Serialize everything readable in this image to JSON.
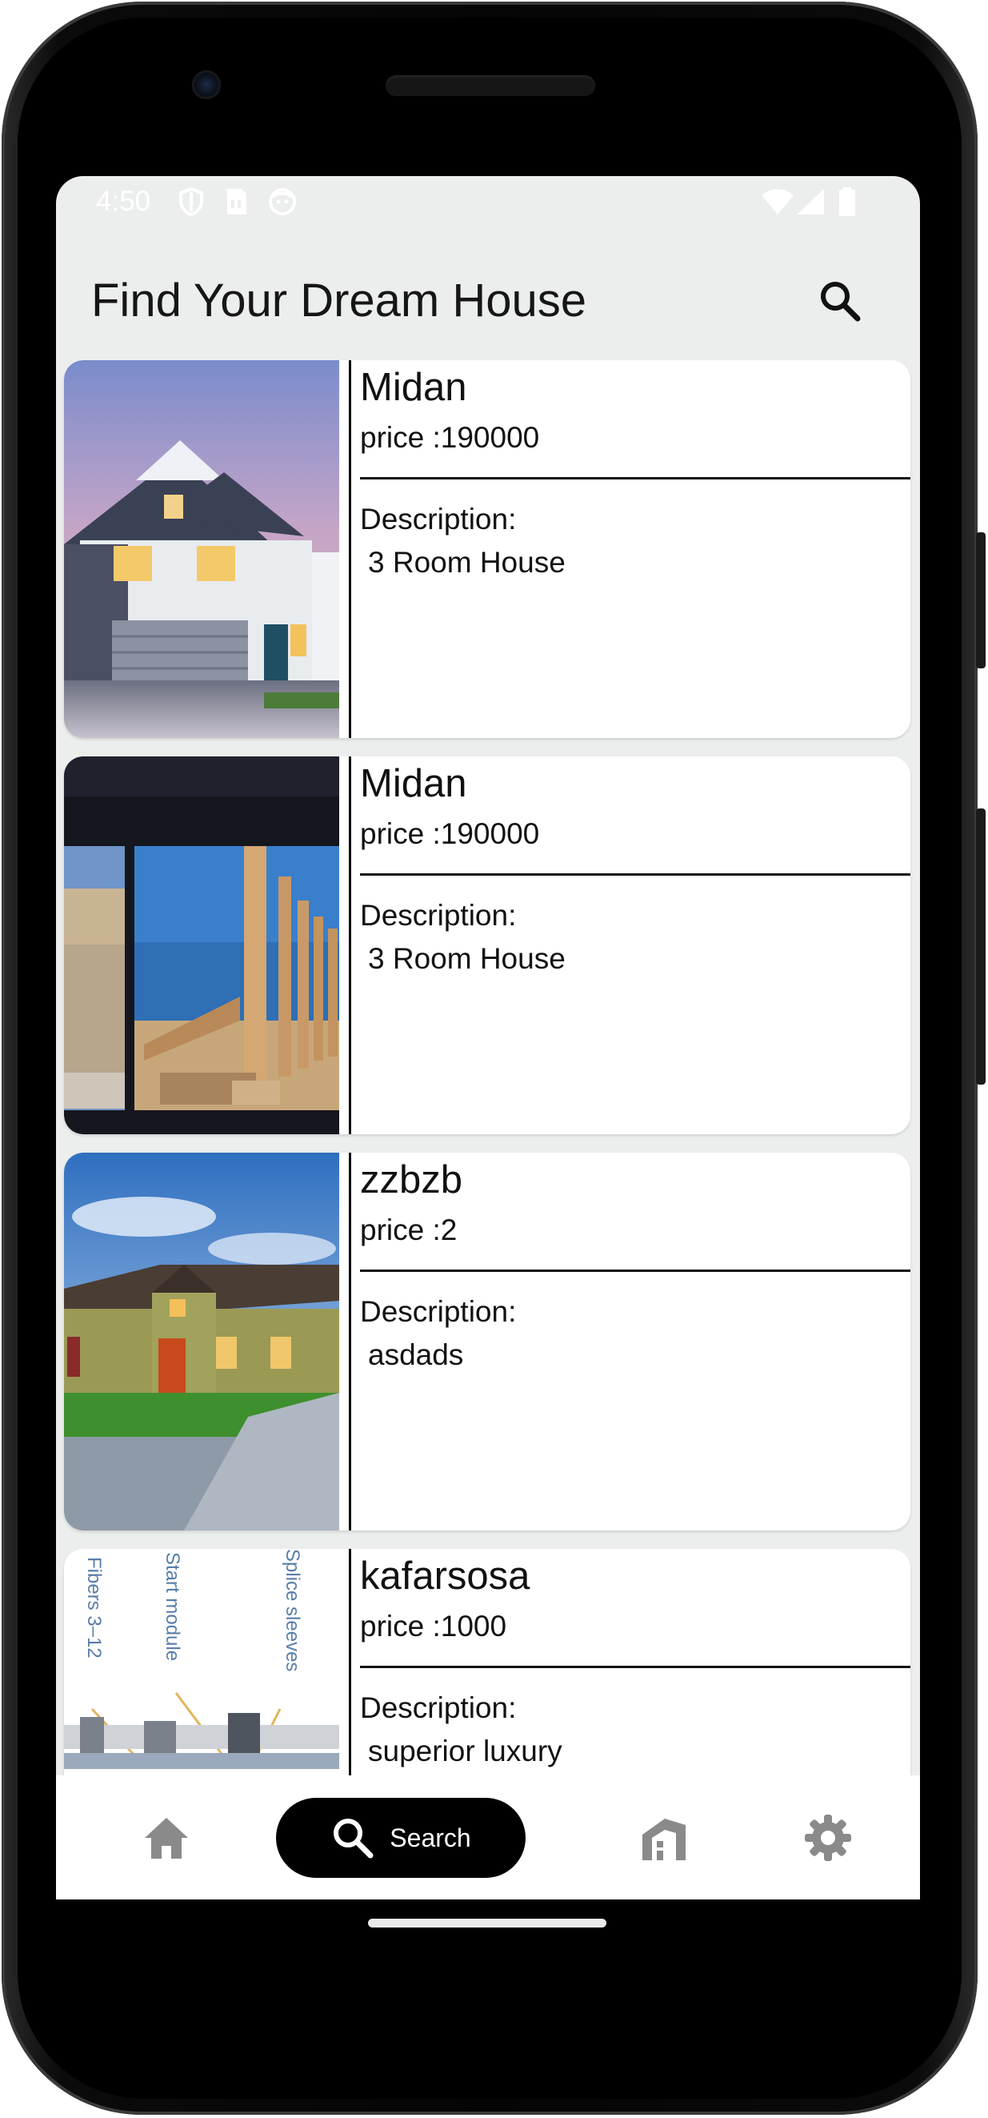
{
  "status_bar": {
    "time": "4:50",
    "icons": [
      "shield-icon",
      "sim-card-icon",
      "face-icon",
      "wifi-icon",
      "cell-signal-icon",
      "battery-icon"
    ]
  },
  "app_bar": {
    "title": "Find Your Dream House",
    "action_icon": "search-icon"
  },
  "listings": [
    {
      "title": "Midan",
      "price": "price :190000",
      "description_label": "Description:",
      "description": "3 Room House",
      "image": "blue-two-story-house-photo"
    },
    {
      "title": "Midan",
      "price": "price :190000",
      "description_label": "Description:",
      "description": "3 Room House",
      "image": "palmyra-columns-screenshot"
    },
    {
      "title": "zzbzb",
      "price": "price :2",
      "description_label": "Description:",
      "description": "asdads",
      "image": "ranch-house-photo"
    },
    {
      "title": "kafarsosa",
      "price": "price :1000",
      "description_label": "Description:",
      "description": "superior luxury",
      "image": "fiber-splice-diagram",
      "image_text": [
        "Fibers 3–12",
        "Start module",
        "Splice sleeves"
      ]
    }
  ],
  "bottom_nav": {
    "items": [
      {
        "icon": "home-icon",
        "label": ""
      },
      {
        "icon": "search-icon",
        "label": "Search",
        "selected": true
      },
      {
        "icon": "buildings-icon",
        "label": ""
      },
      {
        "icon": "gear-icon",
        "label": ""
      }
    ]
  },
  "colors": {
    "screen_background": "#eceeed",
    "card_background": "#ffffff",
    "text": "#111111",
    "nav_selected_pill": "#000000",
    "nav_icon": "#8a8a8a"
  }
}
